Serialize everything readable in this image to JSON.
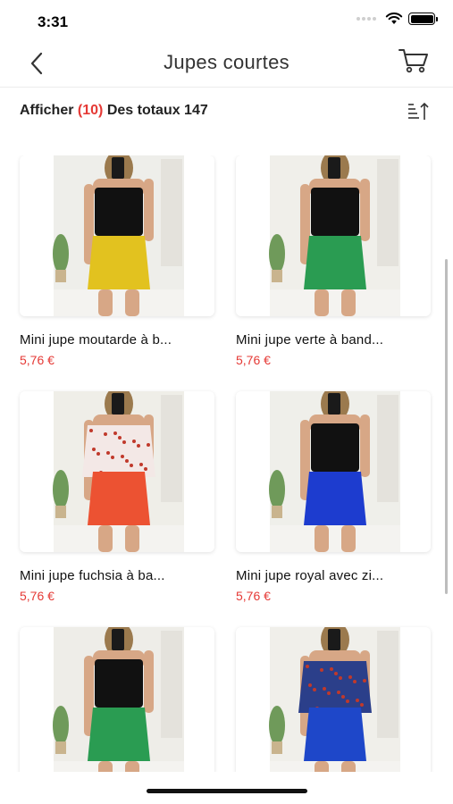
{
  "status": {
    "time": "3:31"
  },
  "nav": {
    "title": "Jupes courtes"
  },
  "filter": {
    "prefix": "Afficher",
    "count": "(10)",
    "suffix": "Des totaux 147"
  },
  "products": [
    {
      "name": "Mini jupe moutarde à b...",
      "price": "5,76 €",
      "skirt_color": "#e2c21f",
      "top_color": "#111111",
      "bg": "#eeeeea",
      "top_style": "tank"
    },
    {
      "name": "Mini jupe verte à band...",
      "price": "5,76 €",
      "skirt_color": "#2a9c52",
      "top_color": "#111111",
      "bg": "#f0efea",
      "top_style": "tank"
    },
    {
      "name": "Mini jupe fuchsia à ba...",
      "price": "5,76 €",
      "skirt_color": "#ec5232",
      "top_color": "#f3e8e6",
      "bg": "#efeee8",
      "top_style": "floral"
    },
    {
      "name": "Mini jupe royal avec zi...",
      "price": "5,76 €",
      "skirt_color": "#1d3ccf",
      "top_color": "#111111",
      "bg": "#efefea",
      "top_style": "tank"
    },
    {
      "name": "",
      "price": "",
      "skirt_color": "#2a9c52",
      "top_color": "#111111",
      "bg": "#eeede8",
      "top_style": "tank"
    },
    {
      "name": "",
      "price": "",
      "skirt_color": "#1e47c9",
      "top_color": "#2b3f8a",
      "bg": "#f0efea",
      "top_style": "floral"
    }
  ]
}
